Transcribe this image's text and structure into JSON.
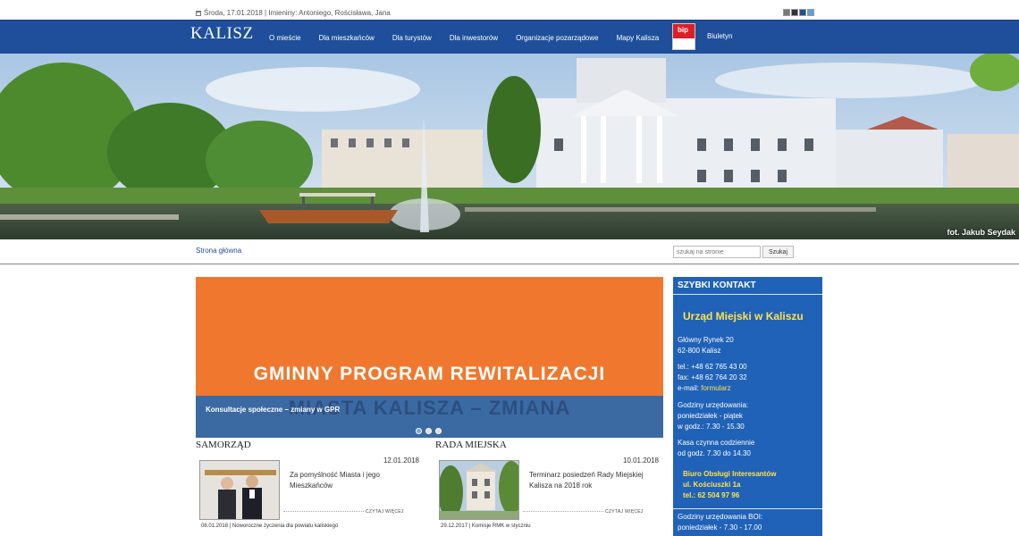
{
  "topbar": {
    "date_text": "Środa, 17.01.2018 | Imieniny: Antoniego, Rościsława, Jana",
    "icon": "calendar-icon",
    "contrast_options": [
      "#777777",
      "#333333",
      "#1f4f9b",
      "#5aa0e0"
    ]
  },
  "nav": {
    "logo": "KALISZ",
    "items": [
      "O mieście",
      "Dla mieszkańców",
      "Dla turystów",
      "Dla inwestorów",
      "Organizacje pozarządowe",
      "Mapy Kalisza"
    ],
    "bip_label": "bip",
    "biuletyn": "Biuletyn"
  },
  "hero": {
    "credit": "fot. Jakub Seydak"
  },
  "breadcrumb": {
    "home": "Strona główna"
  },
  "search": {
    "placeholder": "szukaj na stronie",
    "button": "Szukaj"
  },
  "slider": {
    "headline": "GMINNY PROGRAM REWITALIZACJI",
    "ghost": "MIASTA KALISZA – ZMIANA",
    "caption": "Konsultacje społeczne – zmiany w GPR",
    "active_slide": 1,
    "slide_count": 3
  },
  "samorzad": {
    "title": "SAMORZĄD",
    "date": "12.01.2018",
    "desc": "Za pomyślność Miasta i jego Mieszkańców",
    "more": "CZYTAJ WIĘCEJ",
    "next": "08.01.2018 | Noworoczne życzenia dla powiatu kaliskiego"
  },
  "rada": {
    "title": "RADA MIEJSKA",
    "date": "10.01.2018",
    "desc": "Terminarz posiedzeń Rady Miejskiej Kalisza na 2018 rok",
    "more": "CZYTAJ WIĘCEJ",
    "next": "29.12.2017 | Komisje RMK w styczniu"
  },
  "contact": {
    "heading": "SZYBKI KONTAKT",
    "org": "Urząd Miejski w Kaliszu",
    "addr1": "Główny Rynek 20",
    "addr2": "62-800 Kalisz",
    "tel": "tel.: +48 62 765 43 00",
    "fax": "fax: +48 62 764 20 32",
    "email_label": "e-mail:",
    "email_link": "formularz",
    "hours_label": "Godziny urzędowania:",
    "hours_days": "poniedziałek - piątek",
    "hours_time": "w godz.: 7.30 - 15.30",
    "cash1": "Kasa czynna codziennie",
    "cash2": "od godz. 7.30 do 14.30",
    "boi1": "Biuro Obsługi Interesantów",
    "boi2": "ul. Kościuszki 1a",
    "boi3": "tel.: 62 504 97 96",
    "boi_hours": "Godziny urzędowania BOI:",
    "boi_days": "poniedziałek - 7.30 - 17.00"
  }
}
